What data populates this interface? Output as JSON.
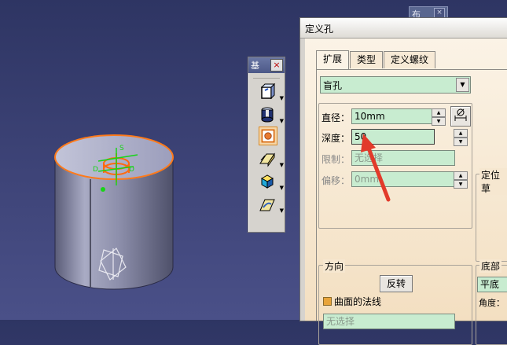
{
  "mini_window": {
    "title": "布",
    "close": "×"
  },
  "palette": {
    "title": "基",
    "close_label": "×",
    "tools": [
      "pad-icon",
      "shaft-icon",
      "hole-icon",
      "rib-icon",
      "solid-icon",
      "stiffener-icon"
    ]
  },
  "sketch_labels": [
    "S",
    "D",
    "D"
  ],
  "dialog": {
    "title": "定义孔",
    "tabs": [
      "扩展",
      "类型",
      "定义螺纹"
    ],
    "hole_type": "盲孔",
    "diameter_label": "直径：",
    "diameter_value": "10mm",
    "depth_label": "深度：",
    "depth_value": "50",
    "limit_label": "限制：",
    "limit_value": "无选择",
    "offset_label": "偏移：",
    "offset_value": "0mm",
    "positioning_label": "定位草",
    "direction_group": "方向",
    "reverse_button": "反转",
    "normal_label": "曲面的法线",
    "direction_value": "无选择",
    "bottom_group": "底部",
    "bottom_value": "平底",
    "angle_label": "角度："
  },
  "colors": {
    "background": "#3a4070",
    "field": "#c8ecd0",
    "panel": "#f6e7d0",
    "accent": "#e8a43a"
  }
}
